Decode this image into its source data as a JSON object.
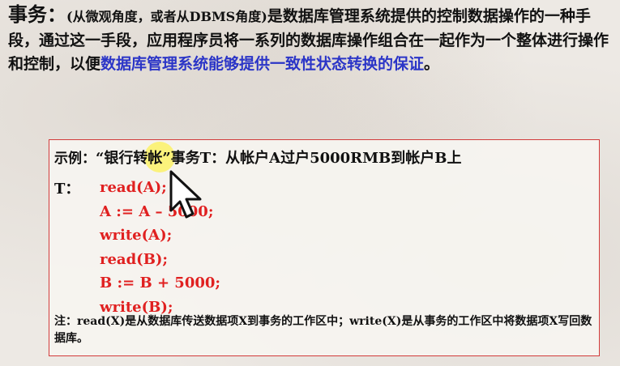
{
  "definition": {
    "term": "事务",
    "colon": "：",
    "paren": "(从微观角度，或者从DBMS角度)",
    "text": "是数据库管理系统提供的控制数据操作的一种手段，通过这一手段，应用程序员将一系列的数据库操作组合在一起作为一个整体进行操作和控制，以便",
    "emphasis": "数据库管理系统能够提供一致性状态转换的保证",
    "end": "。"
  },
  "example": {
    "label": "示例：",
    "text": "“银行转帐”事务T：从帐户A过户5000RMB到帐户B上",
    "t_label": "T：",
    "code": [
      "read(A);",
      "A := A – 5000;",
      "write(A);",
      "read(B);",
      "B := B + 5000;",
      "write(B);"
    ],
    "note": "注：read(X)是从数据库传送数据项X到事务的工作区中；write(X)是从事务的工作区中将数据项X写回数据库。"
  },
  "colors": {
    "emphasis": "#2b35c7",
    "code": "#e02020",
    "border": "#d23b3b"
  }
}
